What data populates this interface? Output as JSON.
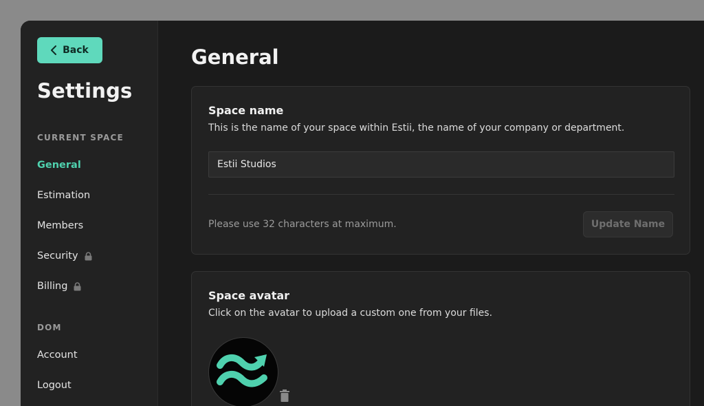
{
  "sidebar": {
    "back_label": "Back",
    "title": "Settings",
    "sections": [
      {
        "label": "CURRENT SPACE",
        "items": [
          {
            "label": "General",
            "active": true,
            "locked": false
          },
          {
            "label": "Estimation",
            "active": false,
            "locked": false
          },
          {
            "label": "Members",
            "active": false,
            "locked": false
          },
          {
            "label": "Security",
            "active": false,
            "locked": true
          },
          {
            "label": "Billing",
            "active": false,
            "locked": true
          }
        ]
      },
      {
        "label": "DOM",
        "items": [
          {
            "label": "Account",
            "active": false,
            "locked": false
          },
          {
            "label": "Logout",
            "active": false,
            "locked": false
          }
        ]
      }
    ]
  },
  "main": {
    "title": "General",
    "space_name": {
      "title": "Space name",
      "description": "This is the name of your space within Estii, the name of your company or department.",
      "input_value": "Estii Studios",
      "hint": "Please use 32 characters at maximum.",
      "button_label": "Update Name"
    },
    "space_avatar": {
      "title": "Space avatar",
      "description": "Click on the avatar to upload a custom one from your files."
    }
  },
  "colors": {
    "accent": "#5fd9bc",
    "active_nav": "#4fd1ae",
    "background": "#1b1b1b",
    "card": "#222222"
  },
  "icons": {
    "back": "chevron-left-icon",
    "lock": "lock-icon",
    "avatar": "wave-arrow-logo",
    "delete": "trash-icon"
  }
}
